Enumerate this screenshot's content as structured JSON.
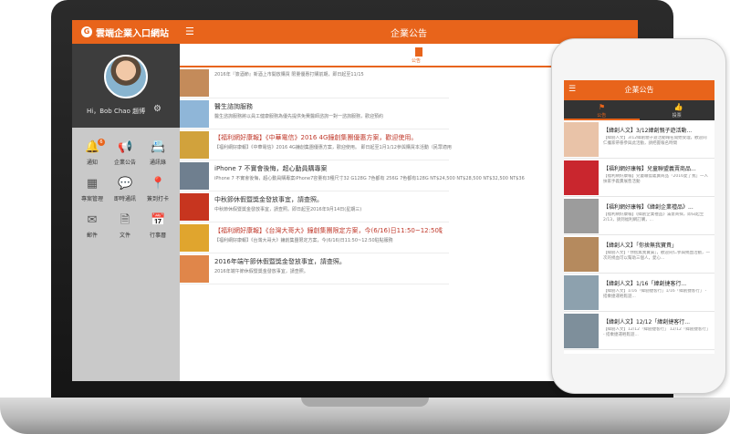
{
  "laptop": {
    "brand": {
      "logo": "G",
      "name": "雲端企業入口網站"
    },
    "user": {
      "greeting": "Hi，Bob Chao 趙博"
    },
    "menu": [
      {
        "label": "通知",
        "icon": "bell-icon",
        "glyph": "🔔",
        "badge": "6"
      },
      {
        "label": "企業公告",
        "icon": "megaphone-icon",
        "glyph": "📢",
        "badge": ""
      },
      {
        "label": "通訊錄",
        "icon": "contacts-icon",
        "glyph": "📇",
        "badge": ""
      },
      {
        "label": "專案管理",
        "icon": "project-icon",
        "glyph": "▦",
        "badge": ""
      },
      {
        "label": "即時通訊",
        "icon": "chat-icon",
        "glyph": "💬",
        "badge": ""
      },
      {
        "label": "簽到打卡",
        "icon": "location-pin-icon",
        "glyph": "📍",
        "badge": ""
      },
      {
        "label": "郵件",
        "icon": "mail-icon",
        "glyph": "✉",
        "badge": ""
      },
      {
        "label": "文件",
        "icon": "document-icon",
        "glyph": "🗎",
        "badge": ""
      },
      {
        "label": "行事曆",
        "icon": "calendar-icon",
        "glyph": "📅",
        "badge": ""
      }
    ],
    "topbar": {
      "title": "企業公告"
    },
    "subtab": {
      "label": "公告"
    },
    "announcements": [
      {
        "title": "",
        "summary": "2016年『簽酒節』新酒上市開放購買 限量優惠打購前期，即日起至11/15",
        "thumb": "#c48b5a"
      },
      {
        "title": "醫生諮詢服務",
        "summary": "醫生諮詢服務將以員工健康服務為優先提供免費醫師諮詢一對一諮詢服務，歡迎預約",
        "thumb": "#8fb6d8"
      },
      {
        "title": "【福利網好康報】《中華電信》2016 4G鐘創集團優惠方案，歡迎使用。",
        "summary": "【福利網好康報】《中華電信》2016 4G鐘創集團優惠方案，歡迎使用。 即日起至1月1/12參與購買本活動（民眾適用）",
        "thumb": "#d1a23c"
      },
      {
        "title": "iPhone 7 不實會後悔，超心動員購專案",
        "summary": "iPhone 7 不實會後悔，超心動員購專案iPhone7容量有3種尺寸32 G128G 7色都有 256G 7色都有128G NT$24,500 NT$28,500 NT$32,500 NT$36,500 NT$8,000 等等，請多利用本內容",
        "thumb": "#6f7f8f"
      },
      {
        "title": "中秋節休假暨獎金發放事宜，請查照。",
        "summary": "中秋節休假暨獎金發放事宜，請查照。即日起至2016年9月14日(星期三)",
        "thumb": "#c7351f"
      },
      {
        "title": "【福利網好康報】《台灣大哥大》鐘創集團限定方案，今(6/16)日11:50~12:50駐點服務，...",
        "summary": "【福利網好康報】《台灣大哥大》鐘創集團限定方案，今(6/16)日11:50~12:50駐點服務",
        "thumb": "#e0a52e"
      },
      {
        "title": "2016年端午節休假暨獎金發放事宜，請查照。",
        "summary": "2016年端午節休假暨獎金發放事宜，請查照。",
        "thumb": "#e0864a"
      }
    ]
  },
  "phone": {
    "topbar": {
      "title": "企業公告"
    },
    "tabs": [
      {
        "label": "公告",
        "icon": "flag-icon",
        "glyph": "⚑"
      },
      {
        "label": "投票",
        "icon": "thumbs-up-icon",
        "glyph": "👍"
      }
    ],
    "items": [
      {
        "title": "【緯創人文】3/12緯創親子遊活動...",
        "summary": "【緯創人文】3/12緯創親子遊活動報名開始受理，歡迎同仁攜家帶眷參與此活動，請把握報名時間",
        "thumb": "#e9c3a8"
      },
      {
        "title": "【福利網好康報】兒童聯盟義賣商品...",
        "summary": "【福利網好康報】兒童聯盟義賣商品「2016愛了我」一人扶家手義賣展售活動",
        "thumb": "#c9262e"
      },
      {
        "title": "【福利網好康報】《緯創企業禮品》...",
        "summary": "【福利網好康報】《緯創企業禮品》滿意商採，即日起至2/13，請到福利網訂購，...",
        "thumb": "#9c9c9c"
      },
      {
        "title": "【緯創人文】「你捨無我寶貴」",
        "summary": "【緯創人文】「你捨無我寶貴」，歡迎同仁參與捐血活動，一次的捐血可以幫助三個人，愛心...",
        "thumb": "#b58a5e"
      },
      {
        "title": "【緯創人文】1/16「緯創捷客行...",
        "summary": "【緯創人文】1/16「緯創捷客行」1/16「緯創捷客行」 - 搭乘捷運輕鬆遊...",
        "thumb": "#8da1ae"
      },
      {
        "title": "【緯創人文】12/12「緯創捷客行...",
        "summary": "【緯創人文】12/12「緯創捷客行」 12/12「緯創捷客行」 - 搭乘捷運輕鬆遊...",
        "thumb": "#7e8f9b"
      }
    ]
  },
  "colors": {
    "accent": "#e8641b",
    "sidebar": "#c9c9c9",
    "profile": "#3d3d3d"
  }
}
